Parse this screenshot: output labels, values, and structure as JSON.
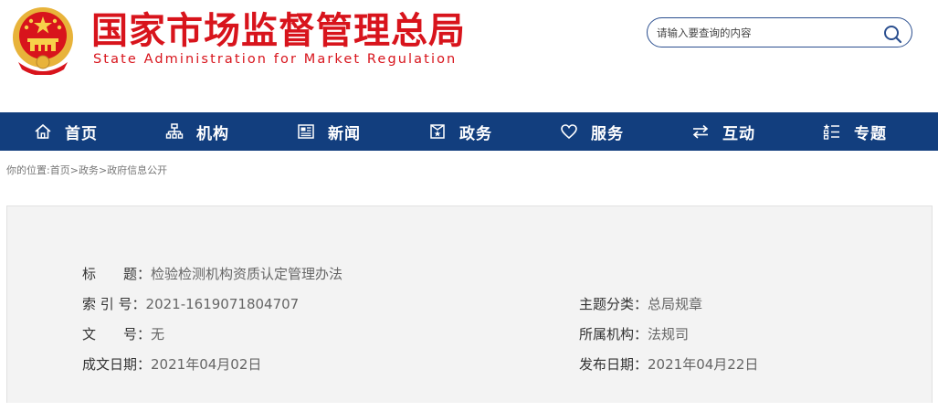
{
  "site": {
    "title_cn": "国家市场监督管理总局",
    "title_en": "State Administration for Market Regulation"
  },
  "search": {
    "placeholder": "请输入要查询的内容"
  },
  "nav": [
    {
      "label": "首页",
      "icon": "home-icon"
    },
    {
      "label": "机构",
      "icon": "org-chart-icon"
    },
    {
      "label": "新闻",
      "icon": "newspaper-icon"
    },
    {
      "label": "政务",
      "icon": "document-icon"
    },
    {
      "label": "服务",
      "icon": "heart-icon"
    },
    {
      "label": "互动",
      "icon": "exchange-icon"
    },
    {
      "label": "专题",
      "icon": "topic-list-icon"
    }
  ],
  "breadcrumb": {
    "prefix": "你的位置:",
    "items": [
      "首页",
      "政务",
      "政府信息公开"
    ],
    "separator": ">"
  },
  "info": {
    "title_key": "标　　题：",
    "title_val": "检验检测机构资质认定管理办法",
    "index_key": "索 引 号：",
    "index_val": "2021-1619071804707",
    "docno_key": "文　　号：",
    "docno_val": "无",
    "date_key": "成文日期：",
    "date_val": "2021年04月02日",
    "topic_key": "主题分类：",
    "topic_val": "总局规章",
    "org_key": "所属机构：",
    "org_val": "法规司",
    "pub_key": "发布日期：",
    "pub_val": "2021年04月22日"
  },
  "colors": {
    "brand_red": "#d8141c",
    "nav_blue": "#123e7e",
    "panel_bg": "#f3f3f3"
  }
}
